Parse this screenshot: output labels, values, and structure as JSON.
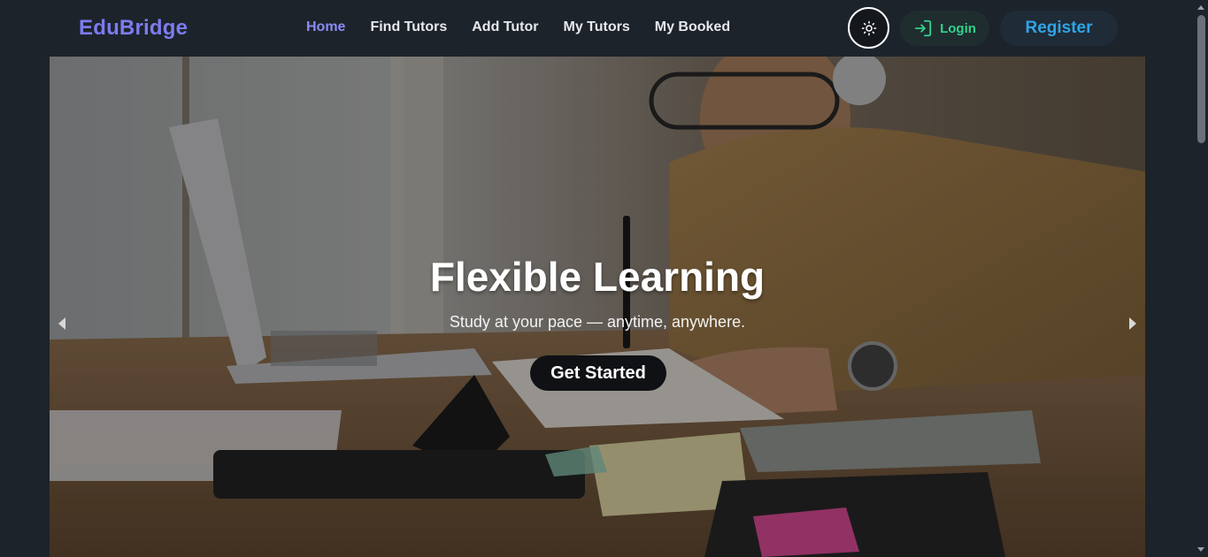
{
  "brand": {
    "name": "EduBridge"
  },
  "nav": {
    "items": [
      {
        "label": "Home",
        "active": true
      },
      {
        "label": "Find Tutors",
        "active": false
      },
      {
        "label": "Add Tutor",
        "active": false
      },
      {
        "label": "My Tutors",
        "active": false
      },
      {
        "label": "My Booked",
        "active": false
      }
    ]
  },
  "actions": {
    "theme_icon": "sun-icon",
    "login_label": "Login",
    "login_icon": "login-icon",
    "register_label": "Register"
  },
  "hero": {
    "title": "Flexible Learning",
    "subtitle": "Study at your pace — anytime, anywhere.",
    "cta_label": "Get Started",
    "prev_icon": "chevron-left-icon",
    "next_icon": "chevron-right-icon"
  },
  "colors": {
    "brand": "#7c7cf0",
    "nav_active": "#8b8bf5",
    "login": "#2fd38a",
    "register": "#2fa5e6",
    "background": "#1d232a"
  }
}
